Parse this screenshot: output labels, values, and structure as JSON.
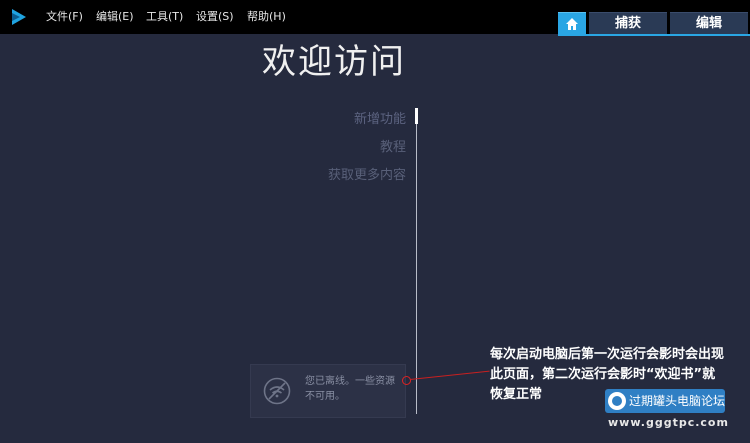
{
  "menu": {
    "items": [
      {
        "label": "文件(F)"
      },
      {
        "label": "编辑(E)"
      },
      {
        "label": "工具(T)"
      },
      {
        "label": "设置(S)"
      },
      {
        "label": "帮助(H)"
      }
    ]
  },
  "tabs": {
    "home_icon": "home-icon",
    "capture_label": "捕获",
    "edit_label": "编辑"
  },
  "main": {
    "title": "欢迎访问",
    "nav": [
      {
        "label": "新增功能"
      },
      {
        "label": "教程"
      },
      {
        "label": "获取更多内容"
      }
    ]
  },
  "offline": {
    "message": "您已离线。一些资源不可用。",
    "icon": "wifi-off-icon"
  },
  "annotation": {
    "text": "每次启动电脑后第一次运行会影时会出现此页面，第二次运行会影时“欢迎书”就恢复正常"
  },
  "watermark": {
    "name": "过期罐头电脑论坛",
    "url": "www.gggtpc.com"
  },
  "colors": {
    "background": "#252a3e",
    "accent": "#2aa6e4",
    "menubar": "#000000"
  }
}
